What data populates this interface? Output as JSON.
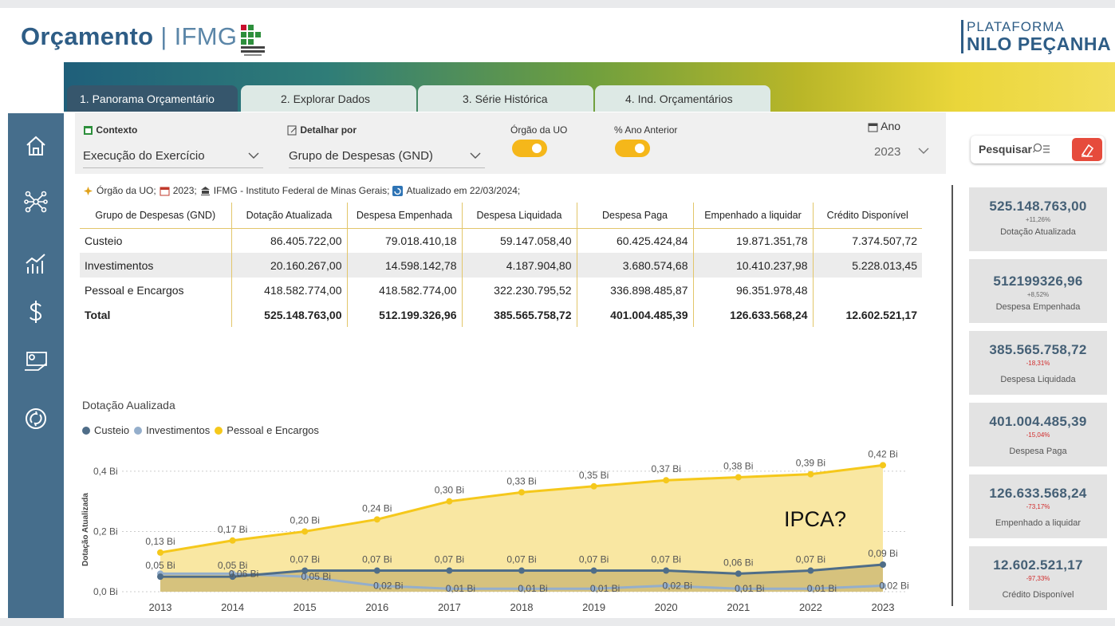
{
  "header": {
    "brand_bold": "Orçamento",
    "brand_sep": "|",
    "brand_thin": "IFMG",
    "platform_line1": "PLATAFORMA",
    "platform_line2": "NILO PEÇANHA"
  },
  "tabs": [
    {
      "label": "1. Panorama Orçamentário",
      "active": true
    },
    {
      "label": "2. Explorar Dados",
      "active": false
    },
    {
      "label": "3. Série Histórica",
      "active": false
    },
    {
      "label": "4. Ind. Orçamentários",
      "active": false
    }
  ],
  "sidebar": {
    "icons": [
      "home-icon",
      "network-icon",
      "chart-icon",
      "dollar-icon",
      "hand-money-icon",
      "cycle-icon"
    ]
  },
  "controls": {
    "contexto_label": "Contexto",
    "contexto_value": "Execução do Exercício",
    "detalhar_label": "Detalhar por",
    "detalhar_value": "Grupo de Despesas (GND)",
    "orgao_label": "Órgão da UO",
    "orgao_on": true,
    "anterior_label": "% Ano Anterior",
    "anterior_on": true,
    "ano_label": "Ano",
    "ano_value": "2023"
  },
  "search": {
    "label": "Pesquisar"
  },
  "info": {
    "orgao": "Órgão da UO;",
    "ano": "2023;",
    "inst": "IFMG - Instituto Federal de Minas Gerais;",
    "upd": "Atualizado em 22/03/2024;"
  },
  "table": {
    "headers": [
      "Grupo de Despesas (GND)",
      "Dotação Atualizada",
      "Despesa Empenhada",
      "Despesa Liquidada",
      "Despesa Paga",
      "Empenhado a liquidar",
      "Crédito Disponível"
    ],
    "rows": [
      [
        "Custeio",
        "86.405.722,00",
        "79.018.410,18",
        "59.147.058,40",
        "60.425.424,84",
        "19.871.351,78",
        "7.374.507,72"
      ],
      [
        "Investimentos",
        "20.160.267,00",
        "14.598.142,78",
        "4.187.904,80",
        "3.680.574,68",
        "10.410.237,98",
        "5.228.013,45"
      ],
      [
        "Pessoal e Encargos",
        "418.582.774,00",
        "418.582.774,00",
        "322.230.795,52",
        "336.898.485,87",
        "96.351.978,48",
        ""
      ]
    ],
    "total": [
      "Total",
      "525.148.763,00",
      "512.199.326,96",
      "385.565.758,72",
      "401.004.485,39",
      "126.633.568,24",
      "12.602.521,17"
    ]
  },
  "kpis": [
    {
      "value": "525.148.763,00",
      "delta": "+11,26%",
      "negative": false,
      "name": "Dotação Atualizada"
    },
    {
      "value": "512199326,96",
      "delta": "+8,52%",
      "negative": false,
      "name": "Despesa Empenhada"
    },
    {
      "value": "385.565.758,72",
      "delta": "-18,31%",
      "negative": true,
      "name": "Despesa Liquidada"
    },
    {
      "value": "401.004.485,39",
      "delta": "-15,04%",
      "negative": true,
      "name": "Despesa Paga"
    },
    {
      "value": "126.633.568,24",
      "delta": "-73,17%",
      "negative": true,
      "name": "Empenhado a liquidar"
    },
    {
      "value": "12.602.521,17",
      "delta": "-97,33%",
      "negative": true,
      "name": "Crédito Disponível"
    }
  ],
  "colors": {
    "custeio": "#4f6d88",
    "investimentos": "#94aecb",
    "pessoal": "#f5c81b",
    "pessoal_fill": "#f9e7a2",
    "kpi_value": "#456076",
    "negative": "#d12c2c",
    "accent_orange": "#f5b71a"
  },
  "chart_data": {
    "type": "area",
    "title": "Dotação Aualizada",
    "ylabel": "Dotação Atualizada",
    "xlabel": "",
    "x": [
      "2013",
      "2014",
      "2015",
      "2016",
      "2017",
      "2018",
      "2019",
      "2020",
      "2021",
      "2022",
      "2023"
    ],
    "y_ticks": [
      "0,0 Bi",
      "0,2 Bi",
      "0,4 Bi"
    ],
    "ylim": [
      0,
      0.45
    ],
    "series": [
      {
        "name": "Custeio",
        "values": [
          0.05,
          0.05,
          0.07,
          0.07,
          0.07,
          0.07,
          0.07,
          0.07,
          0.06,
          0.07,
          0.09
        ],
        "labels": [
          "0,05 Bi",
          "0,05 Bi",
          "0,07 Bi",
          "0,07 Bi",
          "0,07 Bi",
          "0,07 Bi",
          "0,07 Bi",
          "0,07 Bi",
          "0,06 Bi",
          "0,07 Bi",
          "0,09 Bi"
        ]
      },
      {
        "name": "Investimentos",
        "values": [
          0.06,
          0.06,
          0.05,
          0.02,
          0.01,
          0.01,
          0.01,
          0.02,
          0.01,
          0.01,
          0.02
        ],
        "labels": [
          "",
          "0,06 Bi",
          "0,05 Bi",
          "0,02 Bi",
          "0,01 Bi",
          "0,01 Bi",
          "0,01 Bi",
          "0,02 Bi",
          "0,01 Bi",
          "0,01 Bi",
          "0,02 Bi"
        ]
      },
      {
        "name": "Pessoal e Encargos",
        "values": [
          0.13,
          0.17,
          0.2,
          0.24,
          0.3,
          0.33,
          0.35,
          0.37,
          0.38,
          0.39,
          0.42
        ],
        "labels": [
          "0,13 Bi",
          "0,17 Bi",
          "0,20 Bi",
          "0,24 Bi",
          "0,30 Bi",
          "0,33 Bi",
          "0,35 Bi",
          "0,37 Bi",
          "0,38 Bi",
          "0,39 Bi",
          "0,42 Bi"
        ]
      }
    ],
    "annotation": "IPCA?",
    "legend_position": "top-left",
    "grid": true
  }
}
